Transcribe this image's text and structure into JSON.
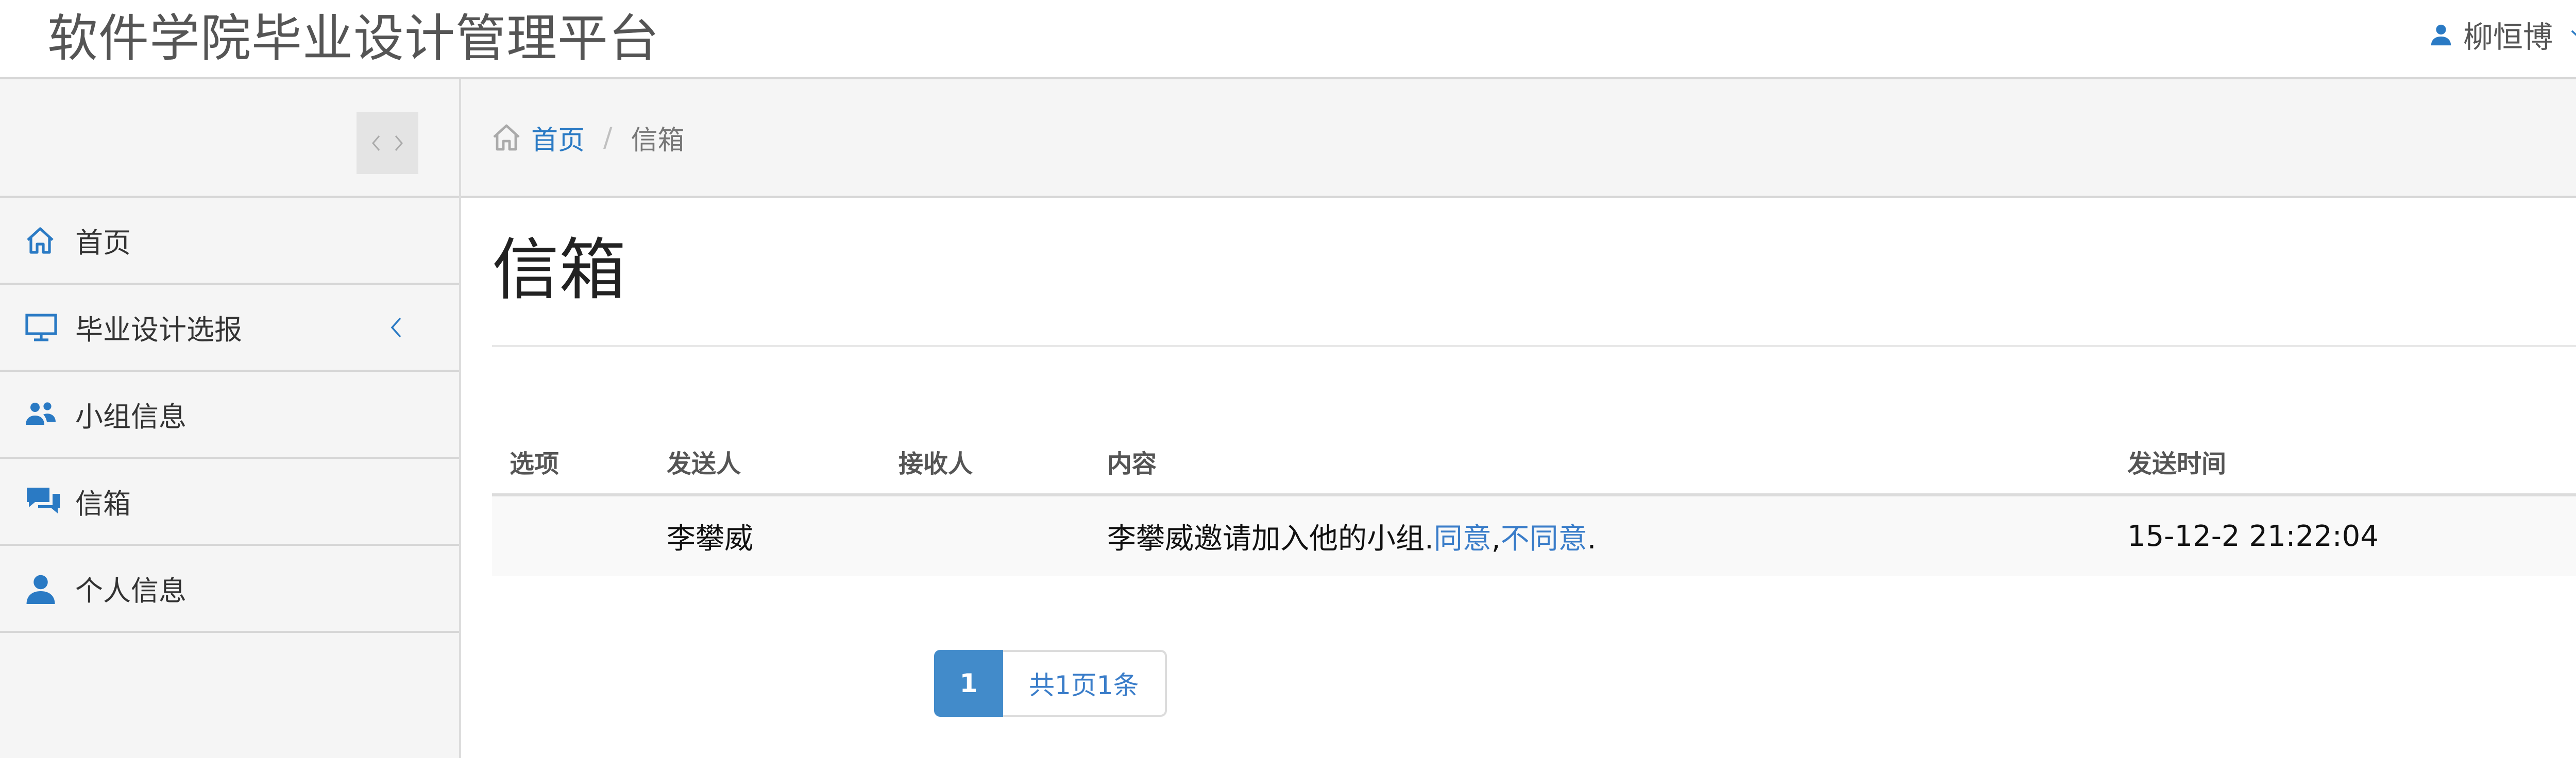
{
  "app": {
    "title": "软件学院毕业设计管理平台"
  },
  "user": {
    "name": "柳恒博",
    "icon": "user-icon",
    "dropdown_icon": "chevron-down-icon"
  },
  "sidebar": {
    "items": [
      {
        "label": "首页",
        "icon": "home-icon"
      },
      {
        "label": "毕业设计选报",
        "icon": "monitor-icon",
        "arrow": "chevron-left-icon"
      },
      {
        "label": "小组信息",
        "icon": "users-icon"
      },
      {
        "label": "信箱",
        "icon": "chat-icon"
      },
      {
        "label": "个人信息",
        "icon": "user-icon"
      }
    ]
  },
  "breadcrumb": {
    "home": "首页",
    "separator": "/",
    "current": "信箱"
  },
  "page": {
    "title": "信箱"
  },
  "table": {
    "headers": [
      "选项",
      "发送人",
      "接收人",
      "内容",
      "发送时间"
    ],
    "rows": [
      {
        "option": "",
        "sender": "李攀威",
        "receiver": "",
        "content_prefix": "李攀威邀请加入他的小组.",
        "accept": "同意",
        "comma": ",",
        "reject": "不同意",
        "period": ".",
        "time": "15-12-2 21:22:04"
      }
    ]
  },
  "pagination": {
    "current_page": "1",
    "summary": "共1页1条"
  },
  "colors": {
    "accent": "#2a7ac4",
    "active_page": "#428bca",
    "sidebar_bg": "#f5f5f5"
  }
}
